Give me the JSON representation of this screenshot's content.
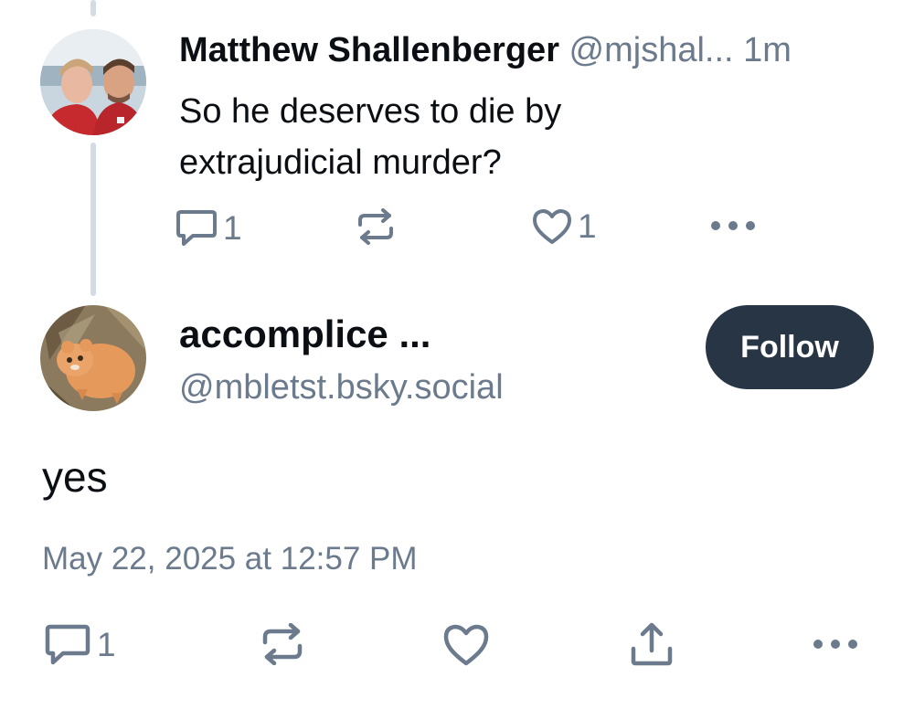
{
  "parent_post": {
    "author_name": "Matthew Shallenberger",
    "author_handle": "@mjshal...",
    "time": "1m",
    "text": "So he deserves to die by extrajudicial murder?",
    "reply_count": "1",
    "like_count": "1",
    "icons": {
      "reply": "reply-icon",
      "repost": "repost-icon",
      "like": "heart-icon",
      "more": "more-icon"
    }
  },
  "main_post": {
    "author_name": "accomplice ...",
    "author_handle": "@mbletst.bsky.social",
    "follow_label": "Follow",
    "text": "yes",
    "date": "May 22, 2025 at 12:57 PM",
    "reply_count": "1",
    "icons": {
      "reply": "reply-icon",
      "repost": "repost-icon",
      "like": "heart-icon",
      "share": "share-icon",
      "more": "more-icon"
    }
  },
  "colors": {
    "text_primary": "#0b0f14",
    "text_muted": "#6b7a8c",
    "thread_line": "#d4dbe2",
    "follow_button_bg": "#283544",
    "follow_button_text": "#ffffff"
  }
}
